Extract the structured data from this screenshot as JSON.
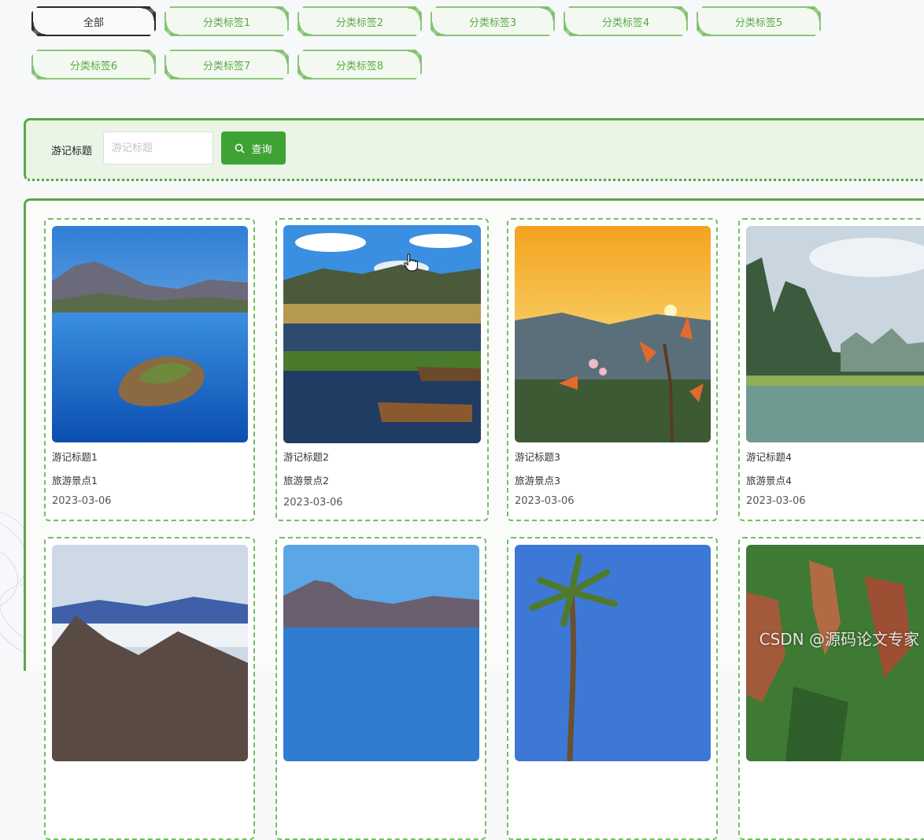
{
  "tags": {
    "row1": [
      {
        "label": "全部",
        "active": true
      },
      {
        "label": "分类标签1",
        "active": false
      },
      {
        "label": "分类标签2",
        "active": false
      },
      {
        "label": "分类标签3",
        "active": false
      },
      {
        "label": "分类标签4",
        "active": false
      },
      {
        "label": "分类标签5",
        "active": false
      }
    ],
    "row2": [
      {
        "label": "分类标签6",
        "active": false
      },
      {
        "label": "分类标签7",
        "active": false
      },
      {
        "label": "分类标签8",
        "active": false
      }
    ]
  },
  "search": {
    "label": "游记标题",
    "placeholder": "游记标题",
    "value": "",
    "button_label": "查询",
    "button_icon": "search-icon"
  },
  "cards": [
    {
      "title": "游记标题1",
      "spot": "旅游景点1",
      "date": "2023-03-06",
      "image": "lake-island"
    },
    {
      "title": "游记标题2",
      "spot": "旅游景点2",
      "date": "2023-03-06",
      "image": "wetland-boats"
    },
    {
      "title": "游记标题3",
      "spot": "旅游景点3",
      "date": "2023-03-06",
      "image": "sunset-flowers"
    },
    {
      "title": "游记标题4",
      "spot": "旅游景点4",
      "date": "2023-03-06",
      "image": "karst-river"
    },
    {
      "title": "",
      "spot": "",
      "date": "",
      "image": "mountain-clouds"
    },
    {
      "title": "",
      "spot": "",
      "date": "",
      "image": "lake-mountain"
    },
    {
      "title": "",
      "spot": "",
      "date": "",
      "image": "palm-beach"
    },
    {
      "title": "",
      "spot": "",
      "date": "",
      "image": "red-canyon"
    }
  ],
  "watermark": "CSDN @源码论文专家",
  "colors": {
    "accent": "#3fa234",
    "border": "#58a846",
    "tag_text": "#5aa845",
    "panel_bg": "#eaf5e6"
  }
}
